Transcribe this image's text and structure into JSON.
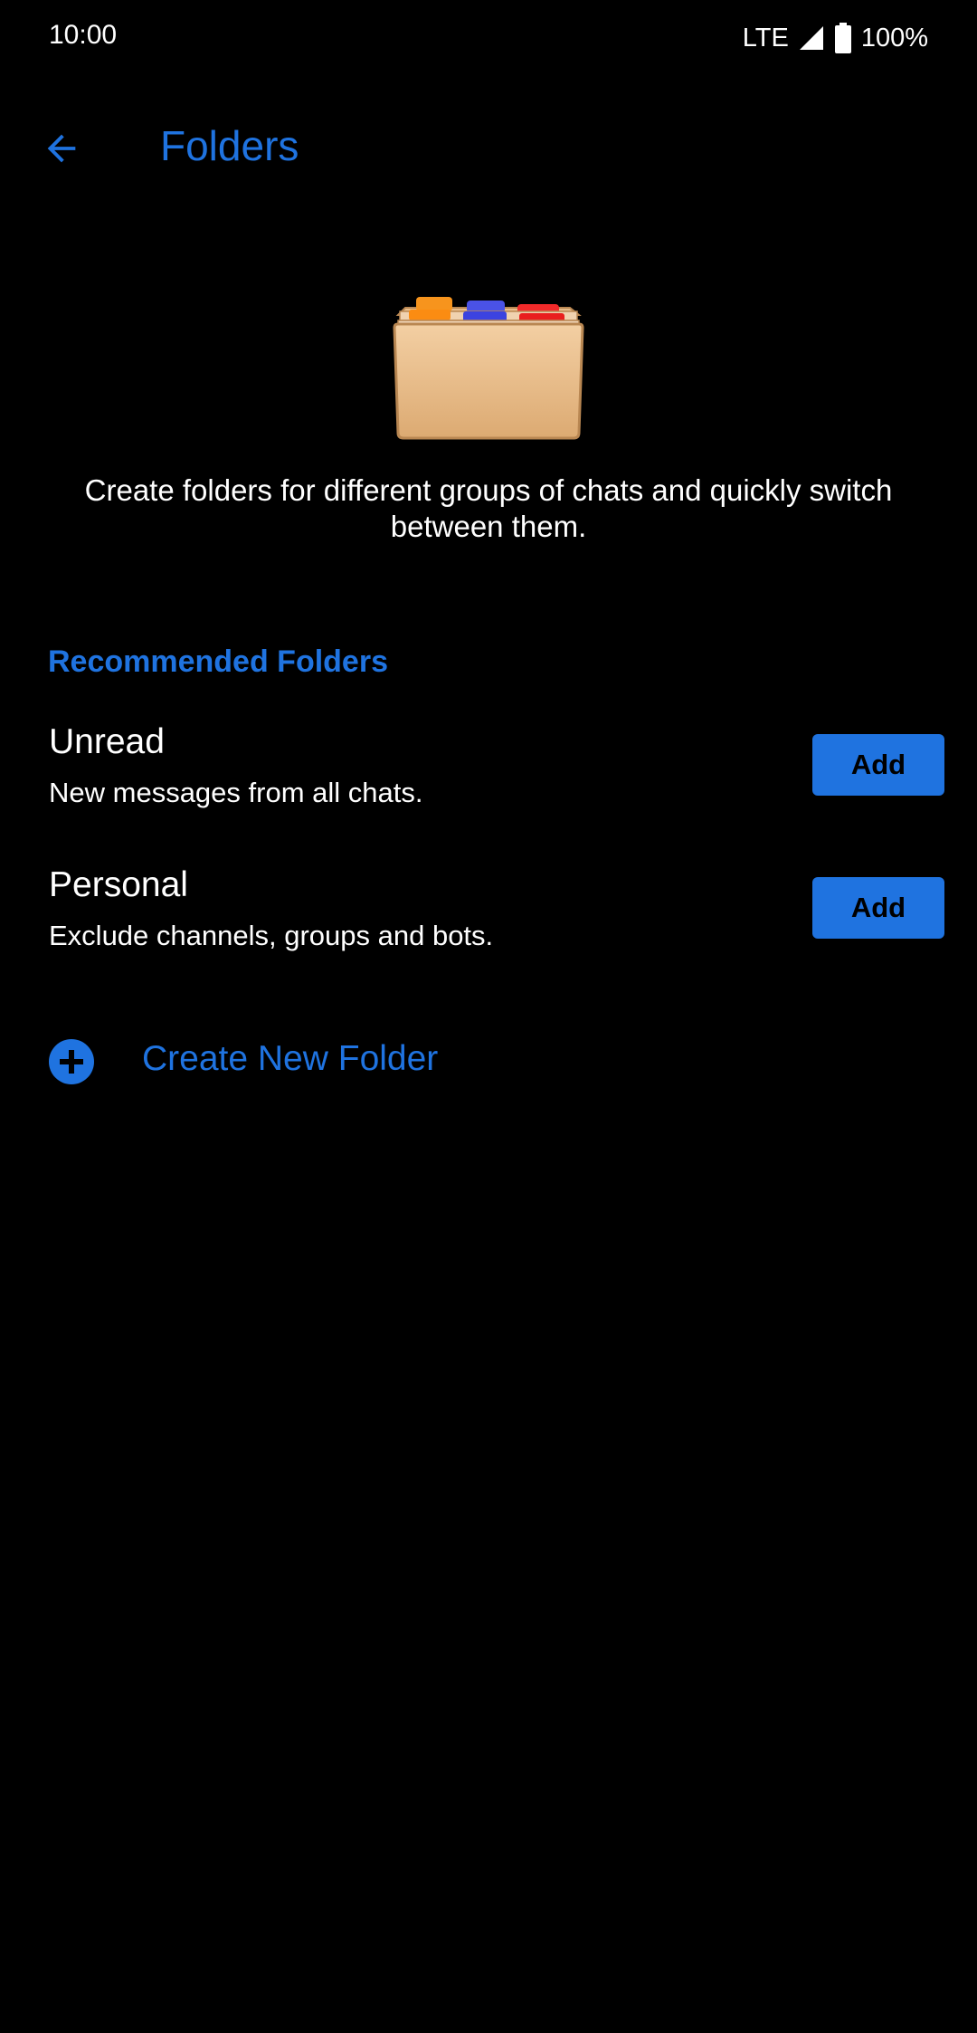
{
  "status_bar": {
    "time": "10:00",
    "network": "LTE",
    "battery": "100%"
  },
  "app_bar": {
    "title": "Folders",
    "back_icon": "arrow-back-icon"
  },
  "illustration": {
    "icon": "card-index-folder-icon"
  },
  "description": "Create folders for different groups of chats and quickly switch between them.",
  "recommended": {
    "header": "Recommended Folders",
    "items": [
      {
        "title": "Unread",
        "subtitle": "New messages from all chats.",
        "button": "Add"
      },
      {
        "title": "Personal",
        "subtitle": "Exclude channels, groups and bots.",
        "button": "Add"
      }
    ]
  },
  "create": {
    "label": "Create New Folder",
    "icon": "plus-circle-icon"
  },
  "colors": {
    "accent": "#1f73e0",
    "background": "#000000",
    "text": "#ffffff"
  }
}
